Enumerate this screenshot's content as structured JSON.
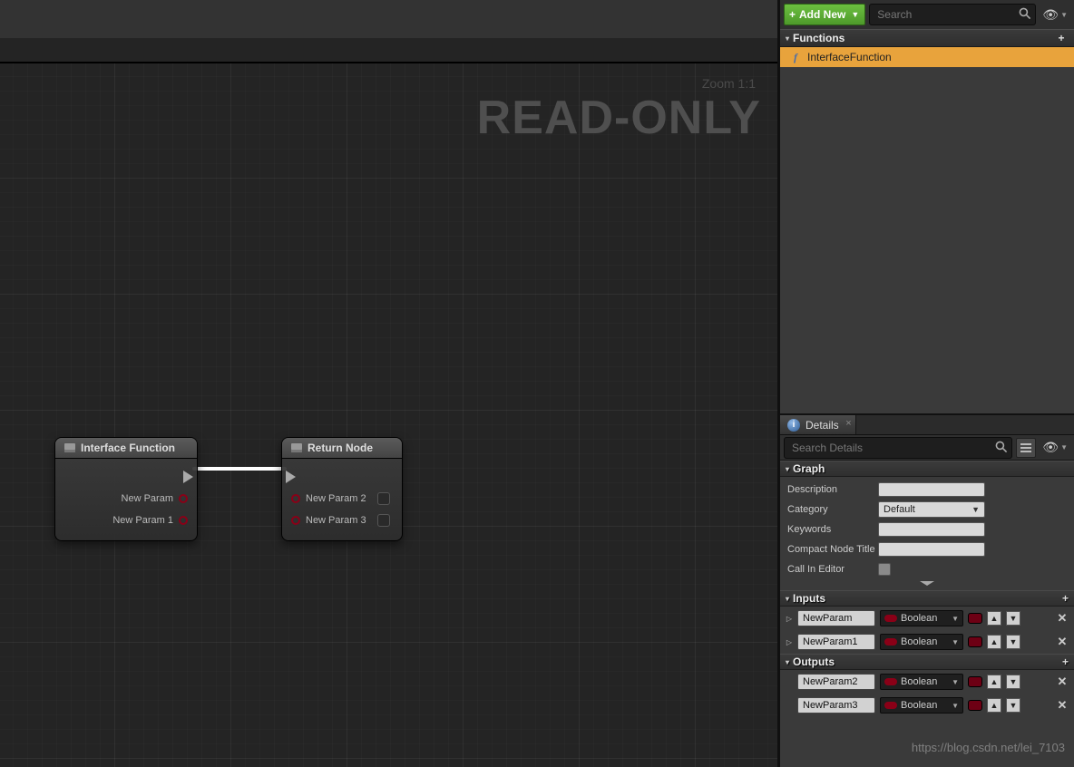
{
  "graph": {
    "zoom_label": "Zoom 1:1",
    "watermark": "READ-ONLY",
    "node_a": {
      "title": "Interface Function",
      "out1": "New Param",
      "out2": "New Param 1"
    },
    "node_b": {
      "title": "Return Node",
      "in1": "New Param 2",
      "in2": "New Param 3"
    }
  },
  "toolbar": {
    "add_new_label": "Add New",
    "search_placeholder": "Search"
  },
  "functions_panel": {
    "header": "Functions",
    "items": [
      {
        "name": "InterfaceFunction"
      }
    ]
  },
  "details": {
    "tab_label": "Details",
    "search_placeholder": "Search Details",
    "graph_section": {
      "title": "Graph",
      "rows": {
        "description_label": "Description",
        "category_label": "Category",
        "category_value": "Default",
        "keywords_label": "Keywords",
        "compact_label": "Compact Node Title",
        "call_in_editor_label": "Call In Editor"
      }
    },
    "inputs_section": {
      "title": "Inputs",
      "params": [
        {
          "name": "NewParam",
          "type": "Boolean"
        },
        {
          "name": "NewParam1",
          "type": "Boolean"
        }
      ]
    },
    "outputs_section": {
      "title": "Outputs",
      "params": [
        {
          "name": "NewParam2",
          "type": "Boolean"
        },
        {
          "name": "NewParam3",
          "type": "Boolean"
        }
      ]
    }
  },
  "watermark_url": "https://blog.csdn.net/lei_7103"
}
